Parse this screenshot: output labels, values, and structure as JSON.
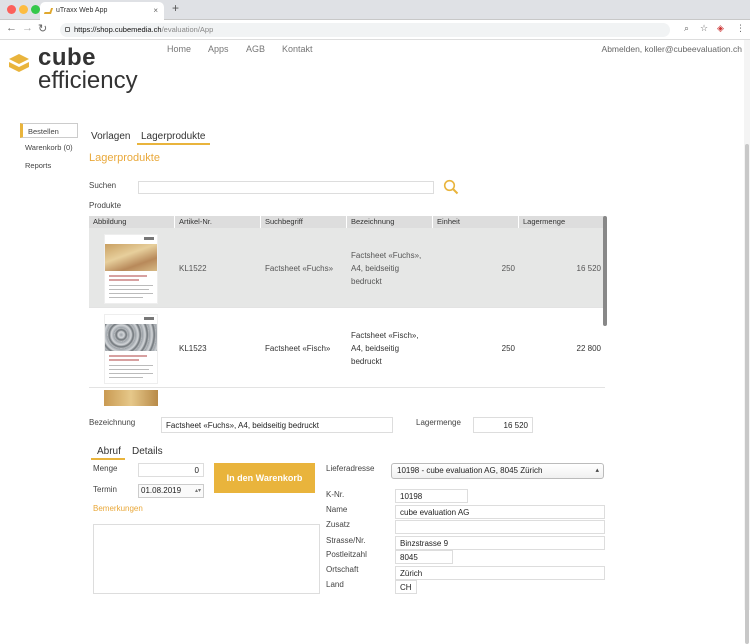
{
  "browser": {
    "tab_title": "uTraxx Web App",
    "tab_close": "×",
    "new_tab": "+",
    "url_host": "https://shop.cubemedia.ch",
    "url_path": "/evaluation/App"
  },
  "brand": {
    "word1": "cube",
    "word2": "efficiency",
    "accent": "#e9b43c"
  },
  "nav": {
    "home": "Home",
    "apps": "Apps",
    "agb": "AGB",
    "kontakt": "Kontakt"
  },
  "account": {
    "text": "Abmelden, koller@cubeevaluation.ch"
  },
  "sidebar": {
    "bestellen": "Bestellen",
    "warenkorb": "Warenkorb (0)",
    "reports": "Reports"
  },
  "tabs": {
    "vorlagen": "Vorlagen",
    "lagerprodukte": "Lagerprodukte"
  },
  "section_title": "Lagerprodukte",
  "search": {
    "label": "Suchen",
    "value": ""
  },
  "produkte_label": "Produkte",
  "table": {
    "headers": {
      "abbildung": "Abbildung",
      "artikel": "Artikel-Nr.",
      "suchbegriff": "Suchbegriff",
      "bezeichnung": "Bezeichnung",
      "einheit": "Einheit",
      "lagermenge": "Lagermenge"
    },
    "rows": [
      {
        "artikel": "KL1522",
        "suchbegriff": "Factsheet «Fuchs»",
        "bezeichnung": "Factsheet «Fuchs», A4, beidseitig bedruckt",
        "einheit": "250",
        "lagermenge": "16 520"
      },
      {
        "artikel": "KL1523",
        "suchbegriff": "Factsheet «Fisch»",
        "bezeichnung": "Factsheet «Fisch», A4, beidseitig bedruckt",
        "einheit": "250",
        "lagermenge": "22 800"
      }
    ]
  },
  "detail": {
    "bezeichnung_label": "Bezeichnung",
    "bezeichnung_value": "Factsheet «Fuchs», A4, beidseitig bedruckt",
    "lagermenge_label": "Lagermenge",
    "lagermenge_value": "16 520"
  },
  "subtabs": {
    "abruf": "Abruf",
    "details": "Details"
  },
  "order": {
    "menge_label": "Menge",
    "menge_value": "0",
    "termin_label": "Termin",
    "termin_value": "01.08.2019",
    "cart_button": "In den Warenkorb",
    "bemerkungen_link": "Bemerkungen"
  },
  "address": {
    "lieferadresse_label": "Lieferadresse",
    "lieferadresse_value": "10198 - cube evaluation AG, 8045 Zürich",
    "knr_label": "K-Nr.",
    "knr_value": "10198",
    "name_label": "Name",
    "name_value": "cube evaluation AG",
    "zusatz_label": "Zusatz",
    "zusatz_value": "",
    "strasse_label": "Strasse/Nr.",
    "strasse_value": "Binzstrasse 9",
    "plz_label": "Postleitzahl",
    "plz_value": "8045",
    "ort_label": "Ortschaft",
    "ort_value": "Zürich",
    "land_label": "Land",
    "land_value": "CH"
  },
  "icons": [
    "back-arrow-icon",
    "forward-arrow-icon",
    "reload-icon",
    "lock-icon",
    "zoom-icon",
    "star-icon",
    "extension-icon",
    "menu-icon",
    "search-icon",
    "cube-logo-icon",
    "chevron-down-icon"
  ]
}
